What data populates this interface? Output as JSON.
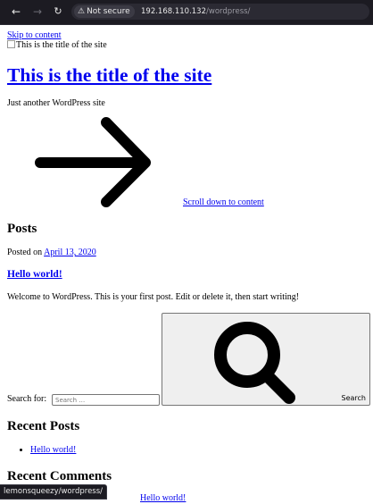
{
  "browser": {
    "security_label": "Not secure",
    "url_host": "192.168.110.132",
    "url_path": "/wordpress/",
    "status_url": "lemonsqueezy/wordpress/"
  },
  "site": {
    "skip_link": "Skip to content",
    "header_image_alt": "This is the title of the site",
    "title": "This is the title of the site",
    "tagline": "Just another WordPress site",
    "scroll_link": "Scroll down to content"
  },
  "posts": {
    "heading": "Posts",
    "posted_prefix": "Posted on ",
    "post_date": "April 13, 2020",
    "post_title": "Hello world!",
    "excerpt": "Welcome to WordPress. This is your first post. Edit or delete it, then start writing!"
  },
  "search": {
    "label": "Search for:",
    "placeholder": "Search …",
    "button_label": "Search"
  },
  "sidebar": {
    "recent_posts_heading": "Recent Posts",
    "recent_posts": [
      "Hello world!"
    ],
    "recent_comments_heading": "Recent Comments",
    "comment_peek": "Hello world!"
  },
  "colors": {
    "link": "#0000ee",
    "chrome_bg": "#1c1b22"
  },
  "icons": [
    "back-arrow-icon",
    "forward-arrow-icon",
    "reload-icon",
    "warning-icon",
    "right-arrow-icon",
    "search-icon"
  ]
}
